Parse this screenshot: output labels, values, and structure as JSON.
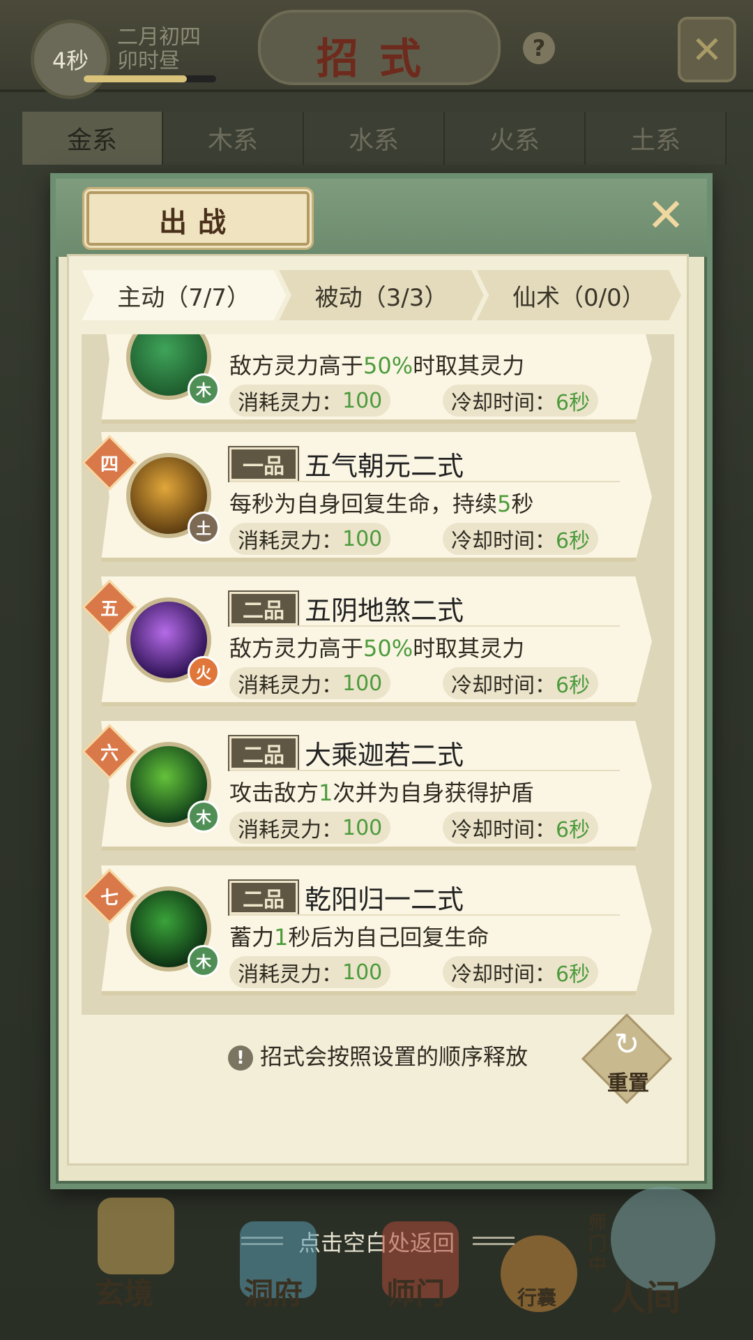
{
  "hud": {
    "timer": "4秒",
    "date_line1": "二月初四",
    "date_line2": "卯时昼",
    "time_progress": 0.78,
    "title": "招式",
    "help": "?"
  },
  "element_tabs": [
    "金系",
    "木系",
    "水系",
    "火系",
    "土系"
  ],
  "element_tab_active": 0,
  "modal": {
    "title": "出战",
    "tabs": [
      "主动（7/7）",
      "被动（3/3）",
      "仙术（0/0）"
    ],
    "active_tab": 0,
    "footer_note": "招式会按照设置的顺序释放",
    "reset_label": "重置"
  },
  "skills": [
    {
      "rank": "",
      "grade": "",
      "name": "",
      "desc_pre": "敌方灵力高于",
      "desc_hl": "50%",
      "desc_post": "时取其灵力",
      "element": "木",
      "element_color": "#4f8f55",
      "icon_colors": [
        "#1d5a2c",
        "#3fa45a"
      ],
      "cost_label": "消耗灵力：",
      "cost": "100",
      "cd_label": "冷却时间：",
      "cd": "6秒"
    },
    {
      "rank": "四",
      "grade": "一品",
      "name": "五气朝元二式",
      "desc_pre": "每秒为自身回复生命，持续",
      "desc_hl": "5",
      "desc_post": "秒",
      "element": "土",
      "element_color": "#7c6a55",
      "icon_colors": [
        "#5a3a10",
        "#e2a73a"
      ],
      "cost_label": "消耗灵力：",
      "cost": "100",
      "cd_label": "冷却时间：",
      "cd": "6秒"
    },
    {
      "rank": "五",
      "grade": "二品",
      "name": "五阴地煞二式",
      "desc_pre": "敌方灵力高于",
      "desc_hl": "50%",
      "desc_post": "时取其灵力",
      "element": "火",
      "element_color": "#e0763a",
      "icon_colors": [
        "#2a1050",
        "#b56be8"
      ],
      "cost_label": "消耗灵力：",
      "cost": "100",
      "cd_label": "冷却时间：",
      "cd": "6秒"
    },
    {
      "rank": "六",
      "grade": "二品",
      "name": "大乘迦若二式",
      "desc_pre": "攻击敌方",
      "desc_hl": "1",
      "desc_post": "次并为自身获得护盾",
      "element": "木",
      "element_color": "#4f8f55",
      "icon_colors": [
        "#0d3a18",
        "#64c23a"
      ],
      "cost_label": "消耗灵力：",
      "cost": "100",
      "cd_label": "冷却时间：",
      "cd": "6秒"
    },
    {
      "rank": "七",
      "grade": "二品",
      "name": "乾阳归一二式",
      "desc_pre": "蓄力",
      "desc_hl": "1",
      "desc_post": "秒后为自己回复生命",
      "element": "木",
      "element_color": "#4f8f55",
      "icon_colors": [
        "#0c2e12",
        "#3aa33a"
      ],
      "cost_label": "消耗灵力：",
      "cost": "100",
      "cd_label": "冷却时间：",
      "cd": "6秒"
    }
  ],
  "hint": "点击空白处返回",
  "bottom_nav": [
    {
      "label": "玄境",
      "color": "#c9a85a"
    },
    {
      "label": "洞府",
      "color": "#5a9ab0"
    },
    {
      "label": "师门",
      "color": "#b04a3a"
    },
    {
      "label": "行囊",
      "color": "#c98a3a"
    },
    {
      "label": "人间",
      "color": "#7aa0a0"
    }
  ],
  "sect_badge": "师门中"
}
